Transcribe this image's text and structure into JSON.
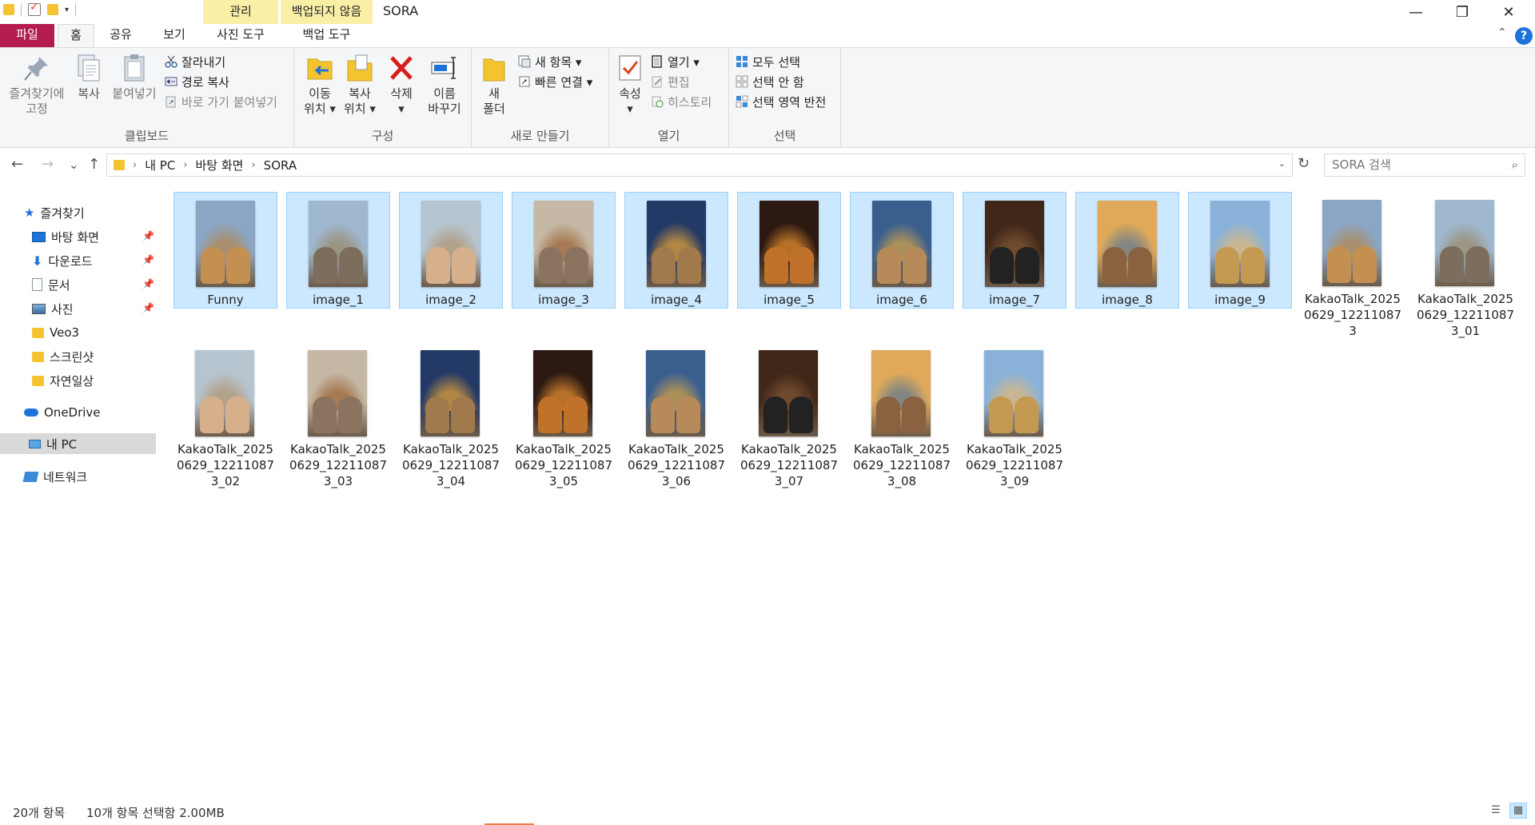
{
  "titlebar": {
    "title": "SORA",
    "context_tabs": [
      {
        "label": "관리"
      },
      {
        "label": "백업되지 않음"
      }
    ],
    "minimize": "—",
    "restore": "❐",
    "close": "✕",
    "qat_dropdown": "▾"
  },
  "tabs": {
    "file": "파일",
    "home": "홈",
    "share": "공유",
    "view": "보기",
    "photo_tools": "사진 도구",
    "backup_tools": "백업 도구",
    "help": "?",
    "collapse": "⌃"
  },
  "ribbon": {
    "clipboard": {
      "label": "클립보드",
      "pin": "즐겨찾기에\n고정",
      "copy": "복사",
      "paste": "붙여넣기",
      "cut": "잘라내기",
      "copy_path": "경로 복사",
      "paste_shortcut": "바로 가기 붙여넣기"
    },
    "organize": {
      "label": "구성",
      "move_to": "이동\n위치 ▾",
      "copy_to": "복사\n위치 ▾",
      "delete": "삭제\n▾",
      "rename": "이름\n바꾸기"
    },
    "new": {
      "label": "새로 만들기",
      "new_folder": "새\n폴더",
      "new_item": "새 항목 ▾",
      "easy_access": "빠른 연결 ▾"
    },
    "open": {
      "label": "열기",
      "properties": "속성\n▾",
      "open": "열기 ▾",
      "edit": "편집",
      "history": "히스토리"
    },
    "select": {
      "label": "선택",
      "select_all": "모두 선택",
      "select_none": "선택 안 함",
      "invert": "선택 영역 반전"
    }
  },
  "address": {
    "back": "←",
    "forward": "→",
    "recent": "⌄",
    "up": "↑",
    "crumbs": [
      "내 PC",
      "바탕 화면",
      "SORA"
    ],
    "crumb_sep": "›",
    "dropdown": "⌄",
    "refresh": "↻",
    "search_placeholder": "SORA 검색",
    "search_icon": "⌕"
  },
  "nav": {
    "quick_access": "즐겨찾기",
    "items": [
      {
        "label": "바탕 화면",
        "icon": "desktop-icon"
      },
      {
        "label": "다운로드",
        "icon": "download-icon"
      },
      {
        "label": "문서",
        "icon": "document-icon"
      },
      {
        "label": "사진",
        "icon": "pictures-icon"
      },
      {
        "label": "Veo3",
        "icon": "folder-icon"
      },
      {
        "label": "스크린샷",
        "icon": "folder-icon"
      },
      {
        "label": "자연일상",
        "icon": "folder-icon"
      }
    ],
    "pin_glyph": "📌",
    "onedrive": "OneDrive",
    "this_pc": "내 PC",
    "network": "네트워크"
  },
  "files": [
    {
      "name": "Funny",
      "selected": true,
      "bg": "#8aa6c4",
      "lm": "#b08a5a",
      "animal": "#c49052"
    },
    {
      "name": "image_1",
      "selected": true,
      "bg": "#9fb8cf",
      "lm": "#9a8d72",
      "animal": "#7d6d5d"
    },
    {
      "name": "image_2",
      "selected": true,
      "bg": "#b6c4cf",
      "lm": "#b0997a",
      "animal": "#d6b08a"
    },
    {
      "name": "image_3",
      "selected": true,
      "bg": "#c5b9a5",
      "lm": "#a06a3f",
      "animal": "#8a7460"
    },
    {
      "name": "image_4",
      "selected": true,
      "bg": "#243a66",
      "lm": "#d39a3a",
      "animal": "#a07a4a"
    },
    {
      "name": "image_5",
      "selected": true,
      "bg": "#2c1a12",
      "lm": "#d9862e",
      "animal": "#c0722a"
    },
    {
      "name": "image_6",
      "selected": true,
      "bg": "#3a5f8f",
      "lm": "#c79c4d",
      "animal": "#b78a5a"
    },
    {
      "name": "image_7",
      "selected": true,
      "bg": "#402718",
      "lm": "#7a5233",
      "animal": "#222222"
    },
    {
      "name": "image_8",
      "selected": true,
      "bg": "#e0a95a",
      "lm": "#6a7e8c",
      "animal": "#8a6240"
    },
    {
      "name": "image_9",
      "selected": true,
      "bg": "#8ab2d8",
      "lm": "#d8b780",
      "animal": "#c49a52"
    },
    {
      "name": "KakaoTalk_20250629_122110873",
      "selected": false,
      "bg": "#8aa6c4",
      "lm": "#b08a5a",
      "animal": "#c49052"
    },
    {
      "name": "KakaoTalk_20250629_122110873_01",
      "selected": false,
      "bg": "#9fb8cf",
      "lm": "#9a8d72",
      "animal": "#7d6d5d"
    },
    {
      "name": "KakaoTalk_20250629_122110873_02",
      "selected": false,
      "bg": "#b6c4cf",
      "lm": "#b0997a",
      "animal": "#d6b08a"
    },
    {
      "name": "KakaoTalk_20250629_122110873_03",
      "selected": false,
      "bg": "#c5b9a5",
      "lm": "#a06a3f",
      "animal": "#8a7460"
    },
    {
      "name": "KakaoTalk_20250629_122110873_04",
      "selected": false,
      "bg": "#243a66",
      "lm": "#d39a3a",
      "animal": "#a07a4a"
    },
    {
      "name": "KakaoTalk_20250629_122110873_05",
      "selected": false,
      "bg": "#2c1a12",
      "lm": "#d9862e",
      "animal": "#c0722a"
    },
    {
      "name": "KakaoTalk_20250629_122110873_06",
      "selected": false,
      "bg": "#3a5f8f",
      "lm": "#c79c4d",
      "animal": "#b78a5a"
    },
    {
      "name": "KakaoTalk_20250629_122110873_07",
      "selected": false,
      "bg": "#402718",
      "lm": "#7a5233",
      "animal": "#222222"
    },
    {
      "name": "KakaoTalk_20250629_122110873_08",
      "selected": false,
      "bg": "#e0a95a",
      "lm": "#6a7e8c",
      "animal": "#8a6240"
    },
    {
      "name": "KakaoTalk_20250629_122110873_09",
      "selected": false,
      "bg": "#8ab2d8",
      "lm": "#d8b780",
      "animal": "#c49a52"
    }
  ],
  "status": {
    "count": "20개 항목",
    "selection": "10개 항목 선택함 2.00MB",
    "details_view": "☰",
    "large_icons_view": "▦"
  },
  "colors": {
    "file_tab": "#b31c4c",
    "context_tab": "#f9f0a6",
    "selection": "#cce8ff",
    "selection_border": "#99d1ff",
    "help": "#1e73d9"
  }
}
